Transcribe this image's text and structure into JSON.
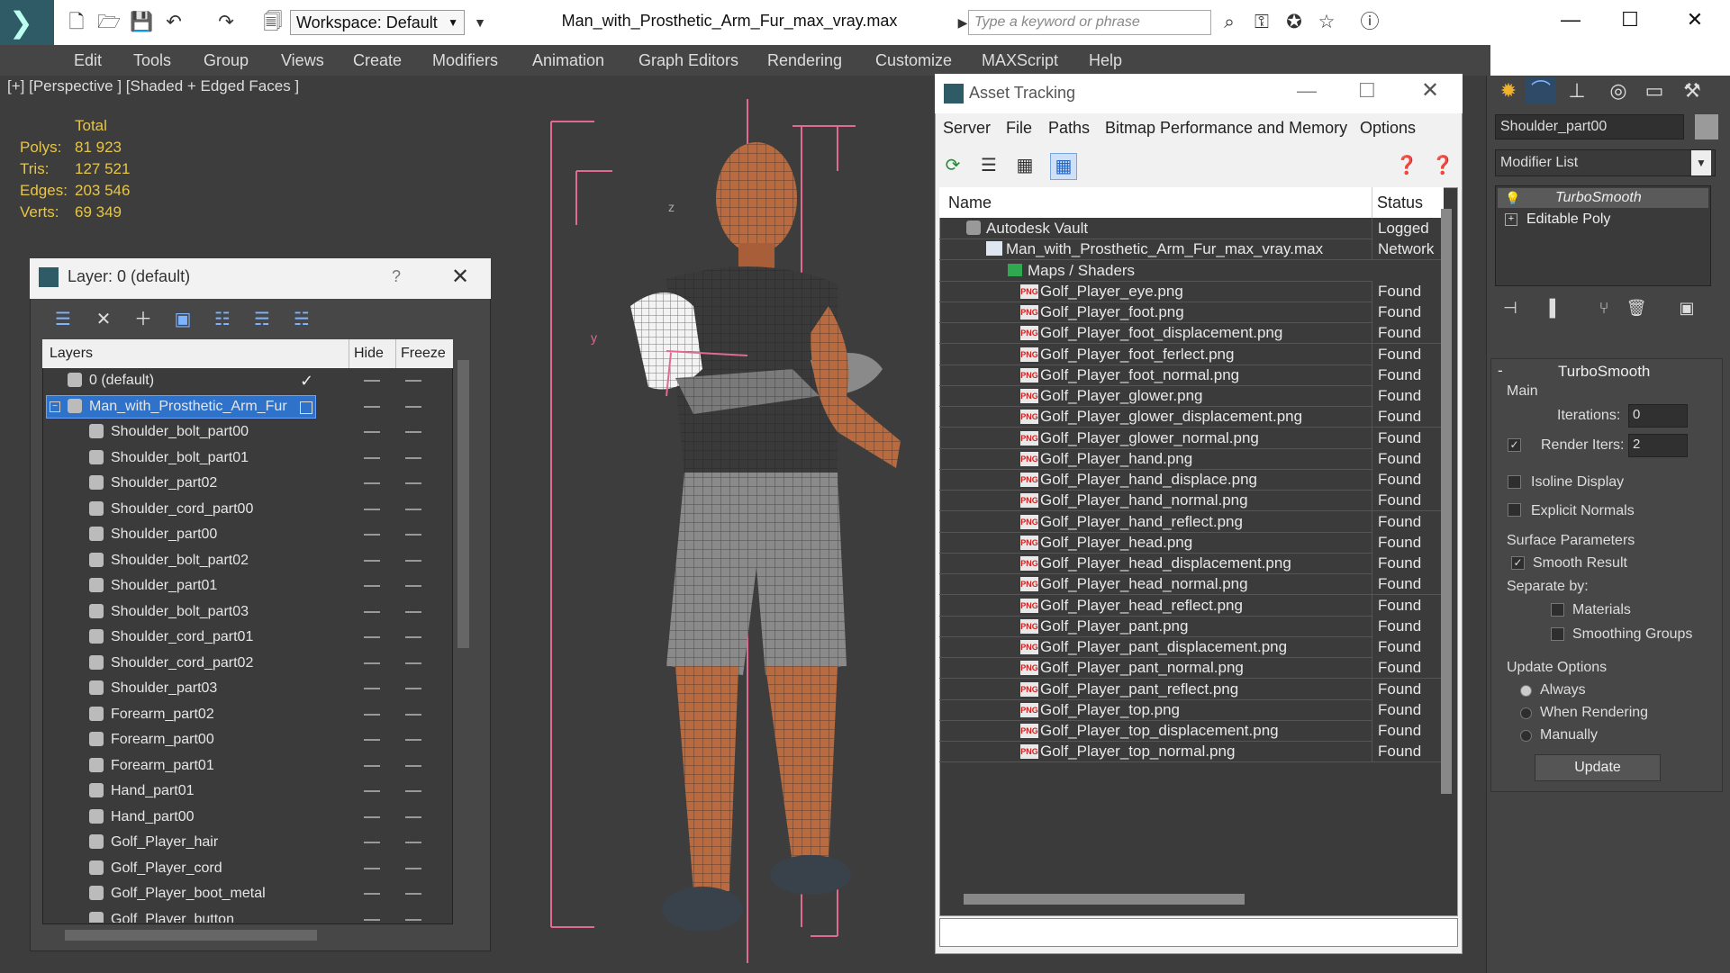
{
  "app": {
    "workspace_label": "Workspace: Default",
    "file_title": "Man_with_Prosthetic_Arm_Fur_max_vray.max",
    "search_placeholder": "Type a keyword or phrase"
  },
  "menu": [
    "Edit",
    "Tools",
    "Group",
    "Views",
    "Create",
    "Modifiers",
    "Animation",
    "Graph Editors",
    "Rendering",
    "Customize",
    "MAXScript",
    "Help"
  ],
  "viewport": {
    "label": "[+] [Perspective ] [Shaded + Edged Faces ]",
    "stats_header": "Total",
    "stats": [
      {
        "label": "Polys:",
        "value": "81 923"
      },
      {
        "label": "Tris:",
        "value": "127 521"
      },
      {
        "label": "Edges:",
        "value": "203 546"
      },
      {
        "label": "Verts:",
        "value": "69 349"
      }
    ],
    "axis_z": "z",
    "axis_y": "y"
  },
  "layer_panel": {
    "title": "Layer: 0 (default)",
    "help": "?",
    "col_layers": "Layers",
    "col_hide": "Hide",
    "col_freeze": "Freeze",
    "rows": [
      {
        "name": "0 (default)",
        "level": 0,
        "active": true
      },
      {
        "name": "Man_with_Prosthetic_Arm_Fur",
        "level": 0,
        "selected": true
      },
      {
        "name": "Shoulder_bolt_part00",
        "level": 1
      },
      {
        "name": "Shoulder_bolt_part01",
        "level": 1
      },
      {
        "name": "Shoulder_part02",
        "level": 1
      },
      {
        "name": "Shoulder_cord_part00",
        "level": 1
      },
      {
        "name": "Shoulder_part00",
        "level": 1
      },
      {
        "name": "Shoulder_bolt_part02",
        "level": 1
      },
      {
        "name": "Shoulder_part01",
        "level": 1
      },
      {
        "name": "Shoulder_bolt_part03",
        "level": 1
      },
      {
        "name": "Shoulder_cord_part01",
        "level": 1
      },
      {
        "name": "Shoulder_cord_part02",
        "level": 1
      },
      {
        "name": "Shoulder_part03",
        "level": 1
      },
      {
        "name": "Forearm_part02",
        "level": 1
      },
      {
        "name": "Forearm_part00",
        "level": 1
      },
      {
        "name": "Forearm_part01",
        "level": 1
      },
      {
        "name": "Hand_part01",
        "level": 1
      },
      {
        "name": "Hand_part00",
        "level": 1
      },
      {
        "name": "Golf_Player_hair",
        "level": 1
      },
      {
        "name": "Golf_Player_cord",
        "level": 1
      },
      {
        "name": "Golf_Player_boot_metal",
        "level": 1
      },
      {
        "name": "Golf_Player_button",
        "level": 1
      }
    ]
  },
  "asset_tracking": {
    "title": "Asset Tracking",
    "menus": [
      "Server",
      "File",
      "Paths",
      "Bitmap Performance and Memory",
      "Options"
    ],
    "col_name": "Name",
    "col_status": "Status",
    "rows": [
      {
        "name": "Autodesk Vault",
        "status": "Logged",
        "level": 0,
        "kind": "vault"
      },
      {
        "name": "Man_with_Prosthetic_Arm_Fur_max_vray.max",
        "status": "Network",
        "level": 1,
        "kind": "max"
      },
      {
        "name": "Maps / Shaders",
        "status": "",
        "level": 2,
        "kind": "maps"
      },
      {
        "name": "Golf_Player_eye.png",
        "status": "Found",
        "level": 3,
        "kind": "png"
      },
      {
        "name": "Golf_Player_foot.png",
        "status": "Found",
        "level": 3,
        "kind": "png"
      },
      {
        "name": "Golf_Player_foot_displacement.png",
        "status": "Found",
        "level": 3,
        "kind": "png"
      },
      {
        "name": "Golf_Player_foot_ferlect.png",
        "status": "Found",
        "level": 3,
        "kind": "png"
      },
      {
        "name": "Golf_Player_foot_normal.png",
        "status": "Found",
        "level": 3,
        "kind": "png"
      },
      {
        "name": "Golf_Player_glower.png",
        "status": "Found",
        "level": 3,
        "kind": "png"
      },
      {
        "name": "Golf_Player_glower_displacement.png",
        "status": "Found",
        "level": 3,
        "kind": "png"
      },
      {
        "name": "Golf_Player_glower_normal.png",
        "status": "Found",
        "level": 3,
        "kind": "png"
      },
      {
        "name": "Golf_Player_hand.png",
        "status": "Found",
        "level": 3,
        "kind": "png"
      },
      {
        "name": "Golf_Player_hand_displace.png",
        "status": "Found",
        "level": 3,
        "kind": "png"
      },
      {
        "name": "Golf_Player_hand_normal.png",
        "status": "Found",
        "level": 3,
        "kind": "png"
      },
      {
        "name": "Golf_Player_hand_reflect.png",
        "status": "Found",
        "level": 3,
        "kind": "png"
      },
      {
        "name": "Golf_Player_head.png",
        "status": "Found",
        "level": 3,
        "kind": "png"
      },
      {
        "name": "Golf_Player_head_displacement.png",
        "status": "Found",
        "level": 3,
        "kind": "png"
      },
      {
        "name": "Golf_Player_head_normal.png",
        "status": "Found",
        "level": 3,
        "kind": "png"
      },
      {
        "name": "Golf_Player_head_reflect.png",
        "status": "Found",
        "level": 3,
        "kind": "png"
      },
      {
        "name": "Golf_Player_pant.png",
        "status": "Found",
        "level": 3,
        "kind": "png"
      },
      {
        "name": "Golf_Player_pant_displacement.png",
        "status": "Found",
        "level": 3,
        "kind": "png"
      },
      {
        "name": "Golf_Player_pant_normal.png",
        "status": "Found",
        "level": 3,
        "kind": "png"
      },
      {
        "name": "Golf_Player_pant_reflect.png",
        "status": "Found",
        "level": 3,
        "kind": "png"
      },
      {
        "name": "Golf_Player_top.png",
        "status": "Found",
        "level": 3,
        "kind": "png"
      },
      {
        "name": "Golf_Player_top_displacement.png",
        "status": "Found",
        "level": 3,
        "kind": "png"
      },
      {
        "name": "Golf_Player_top_normal.png",
        "status": "Found",
        "level": 3,
        "kind": "png"
      }
    ]
  },
  "command_panel": {
    "object_name": "Shoulder_part00",
    "modifier_list": "Modifier List",
    "stack": [
      "TurboSmooth",
      "Editable Poly"
    ],
    "rollout_title": "TurboSmooth",
    "main_group": "Main",
    "iterations_label": "Iterations:",
    "iterations_value": "0",
    "render_iters_label": "Render Iters:",
    "render_iters_value": "2",
    "isoline_label": "Isoline Display",
    "explicit_normals_label": "Explicit Normals",
    "surface_group": "Surface Parameters",
    "smooth_result_label": "Smooth Result",
    "separate_by_label": "Separate by:",
    "materials_label": "Materials",
    "smoothing_groups_label": "Smoothing Groups",
    "update_group": "Update Options",
    "always_label": "Always",
    "when_rendering_label": "When Rendering",
    "manually_label": "Manually",
    "update_button": "Update"
  },
  "colors": {
    "selection": "#2f72c9",
    "stats": "#e6c54a",
    "bbox": "#e06b8e"
  },
  "icons": {
    "png": "PNG"
  }
}
